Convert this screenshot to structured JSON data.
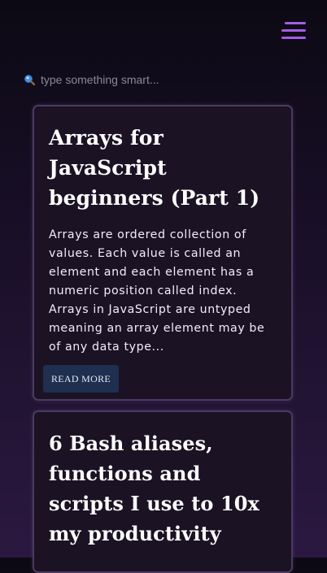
{
  "header": {
    "menu_icon": "hamburger-menu-icon",
    "accent_color": "#a45ee5"
  },
  "search": {
    "icon": "magnifier-icon",
    "placeholder": "type something smart..."
  },
  "posts": [
    {
      "title": "Arrays for JavaScript beginners (Part 1)",
      "excerpt": "Arrays are ordered collection of values. Each value is called an element and each element has a numeric position called index. Arrays in JavaScript are untyped meaning an array element may be of any data type...",
      "button_label": "READ MORE"
    },
    {
      "title": "6 Bash aliases, functions and scripts I use to 10x my productivity"
    }
  ]
}
